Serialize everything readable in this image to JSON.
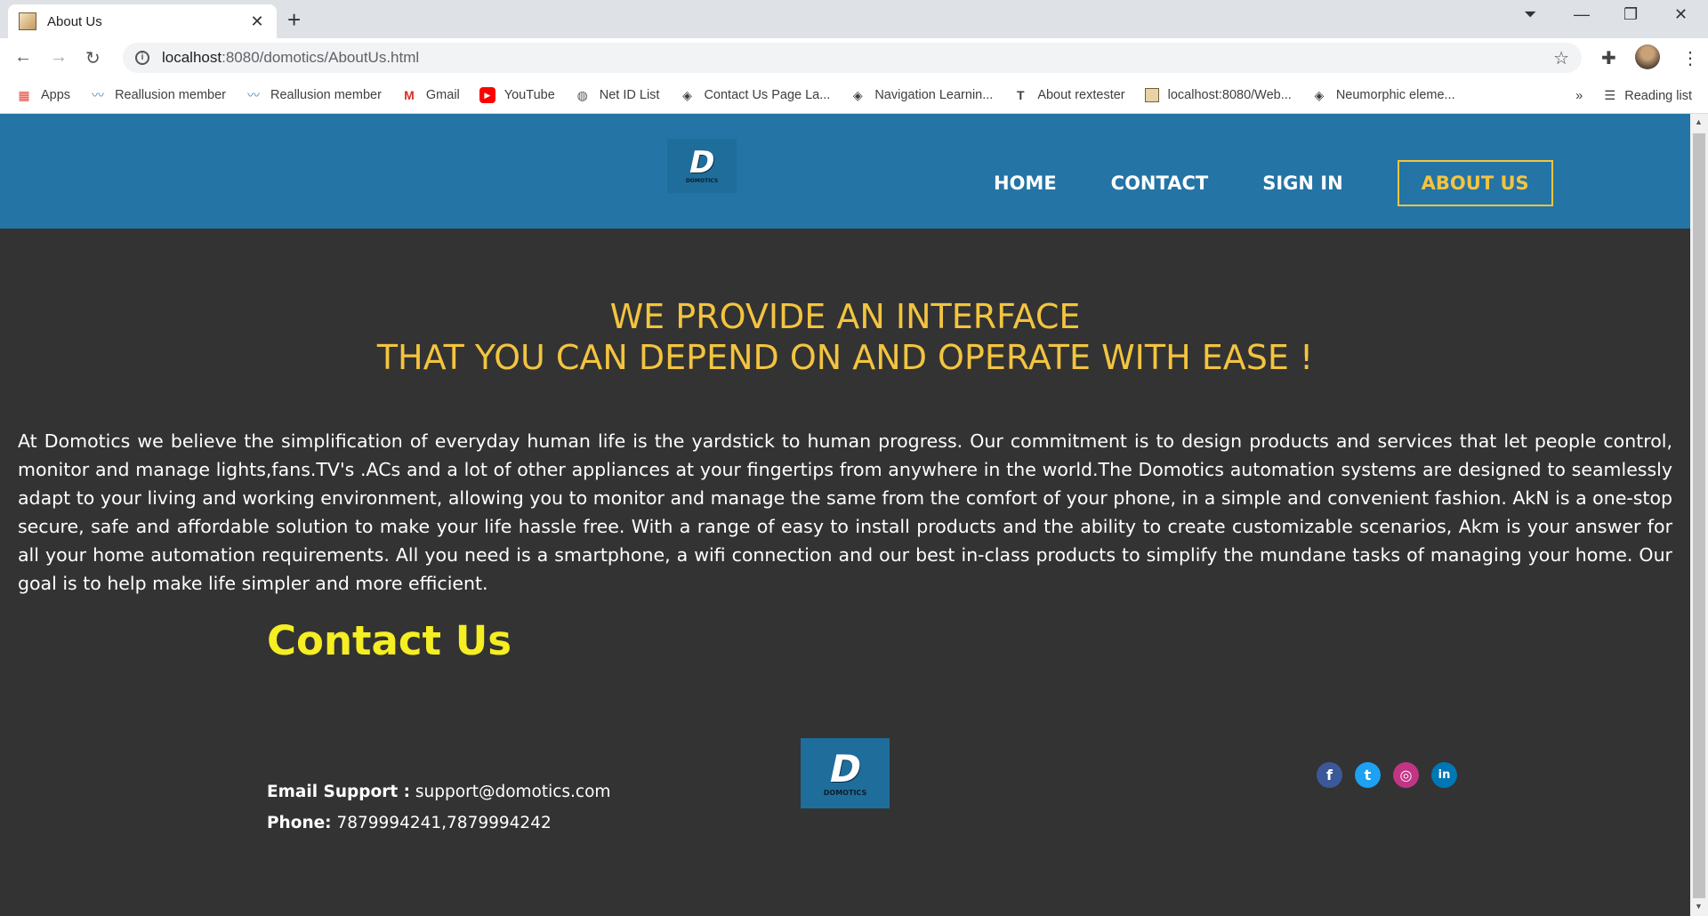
{
  "browser": {
    "tab_title": "About Us",
    "url_host": "localhost",
    "url_rest": ":8080/domotics/AboutUs.html",
    "bookmarks": [
      {
        "label": "Apps",
        "icon": "apps-grid-icon"
      },
      {
        "label": "Reallusion member",
        "icon": "reallusion-icon"
      },
      {
        "label": "Reallusion member",
        "icon": "reallusion-icon"
      },
      {
        "label": "Gmail",
        "icon": "gmail-icon"
      },
      {
        "label": "YouTube",
        "icon": "youtube-icon"
      },
      {
        "label": "Net ID List",
        "icon": "globe-icon"
      },
      {
        "label": "Contact Us Page La...",
        "icon": "codepen-icon"
      },
      {
        "label": "Navigation Learnin...",
        "icon": "codepen-icon"
      },
      {
        "label": "About rextester",
        "icon": "text-t-icon"
      },
      {
        "label": "localhost:8080/Web...",
        "icon": "page-icon"
      },
      {
        "label": "Neumorphic eleme...",
        "icon": "codepen-icon"
      }
    ],
    "more_bookmarks": "»",
    "reading_list": "Reading list"
  },
  "site": {
    "logo_brand": "DOMOTICS",
    "nav": {
      "home": "HOME",
      "contact": "CONTACT",
      "signin": "SIGN IN",
      "about": "ABOUT US"
    },
    "headline_1": "WE PROVIDE AN INTERFACE",
    "headline_2": "THAT YOU CAN DEPEND ON AND OPERATE WITH EASE !",
    "about_text": "At Domotics we believe the simplification of everyday human life is the yardstick to human progress. Our commitment is to design products and services that let people control, monitor and manage lights,fans.TV's .ACs and a lot of other appliances at your fingertips from anywhere in the world.The Domotics automation systems are designed to seamlessly adapt to your living and working environment, allowing you to monitor and manage the same from the comfort of your phone, in a simple and convenient fashion. AkN is a one-stop secure, safe and affordable solution to make your life hassle free. With a range of easy to install products and the ability to create customizable scenarios, Akm is your answer for all your home automation requirements. All you need is a smartphone, a wifi connection and our best in-class products to simplify the mundane tasks of managing your home. Our goal is to help make life simpler and more efficient.",
    "contact": {
      "title": "Contact Us",
      "email_label": "Email Support :",
      "email_value": "support@domotics.com",
      "phone_label": "Phone:",
      "phone_value": "7879994241,7879994242"
    },
    "socials": [
      {
        "name": "facebook-icon",
        "glyph": "f",
        "color": "#3b5998"
      },
      {
        "name": "twitter-icon",
        "glyph": "t",
        "color": "#1da1f2"
      },
      {
        "name": "instagram-icon",
        "glyph": "◎",
        "color": "#c13584"
      },
      {
        "name": "linkedin-icon",
        "glyph": "in",
        "color": "#0077b5"
      }
    ],
    "colors": {
      "header": "#2474a5",
      "accent": "#f3c43f",
      "contact_title": "#f5ee22",
      "background": "#333333"
    }
  }
}
